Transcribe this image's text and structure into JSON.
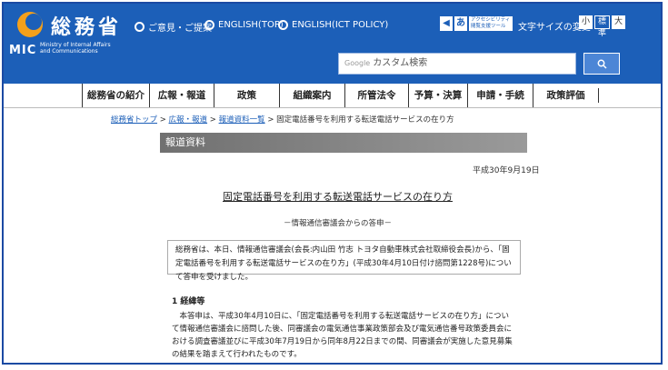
{
  "header": {
    "org_name": "総務省",
    "mic": "MIC",
    "org_english": "Ministry of Internal Affairs and Communications",
    "links": [
      {
        "label": "ご意見・ご提案"
      },
      {
        "label": "ENGLISH(TOP)"
      },
      {
        "label": "ENGLISH(ICT POLICY)"
      }
    ],
    "accessibility_icon": "あ",
    "accessibility_label": "アクセシビリティ 閲覧支援ツール",
    "font_size_label": "文字サイズの変更",
    "font_small": "小",
    "font_normal": "標準",
    "font_large": "大",
    "search_brand": "Google",
    "search_placeholder": "カスタム検索",
    "search_icon": "search-icon"
  },
  "nav": {
    "items": [
      {
        "label": "総務省の紹介"
      },
      {
        "label": "広報・報道"
      },
      {
        "label": "政策"
      },
      {
        "label": "組織案内"
      },
      {
        "label": "所管法令"
      },
      {
        "label": "予算・決算"
      },
      {
        "label": "申請・手続"
      },
      {
        "label": "政策評価"
      }
    ]
  },
  "breadcrumb": {
    "items": [
      "総務省トップ",
      "広報・報道",
      "報道資料一覧"
    ],
    "separator": ">",
    "current": "固定電話番号を利用する転送電話サービスの在り方"
  },
  "main": {
    "section_label": "報道資料",
    "date": "平成30年9月19日",
    "title": "固定電話番号を利用する転送電話サービスの在り方",
    "subtitle": "－情報通信審議会からの答申－",
    "summary": "総務省は、本日、情報通信審議会(会長:内山田 竹志 トヨタ自動車株式会社取締役会長)から、「固定電話番号を利用する転送電話サービスの在り方」(平成30年4月10日付け諮問第1228号)について答申を受けました。",
    "section1_heading": "1 経緯等",
    "section1_body": "本答申は、平成30年4月10日に、「固定電話番号を利用する転送電話サービスの在り方」について情報通信審議会に諮問した後、同審議会の電気通信事業政策部会及び電気通信番号政策委員会における調査審議並びに平成30年7月19日から同年8月22日までの間、同審議会が実施した意見募集の結果を踏まえて行われたものです。"
  },
  "colors": {
    "header_bg": "#1c5fb8",
    "logo_orange": "#f5a01a",
    "link_blue": "#1c5fb8",
    "section_bar": "#7a7a7a"
  }
}
